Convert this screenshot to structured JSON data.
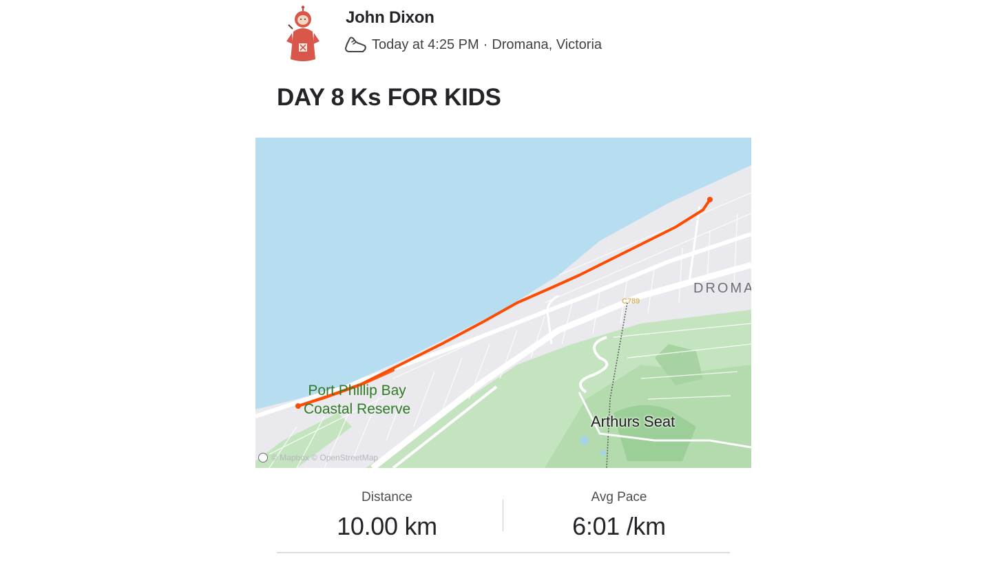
{
  "activity": {
    "athlete_name": "John Dixon",
    "timestamp": "Today at 4:25 PM",
    "separator": "·",
    "location": "Dromana, Victoria",
    "activity_type_icon": "run-shoe-icon",
    "title": "DAY 8 Ks FOR KIDS"
  },
  "map": {
    "labels": {
      "reserve_line1": "Port Phillip Bay",
      "reserve_line2": "Coastal Reserve",
      "peak": "Arthurs Seat",
      "town": "DROMA",
      "road": "C789"
    },
    "attribution": "© Mapbox © OpenStreetMap",
    "colors": {
      "water": "#b6def0",
      "land": "#e9e9ee",
      "park": "#b9dfb5",
      "route": "#fc4c02",
      "reserve_text": "#2f7a24"
    }
  },
  "stats": [
    {
      "label": "Distance",
      "value": "10.00 km"
    },
    {
      "label": "Avg Pace",
      "value": "6:01 /km"
    }
  ]
}
